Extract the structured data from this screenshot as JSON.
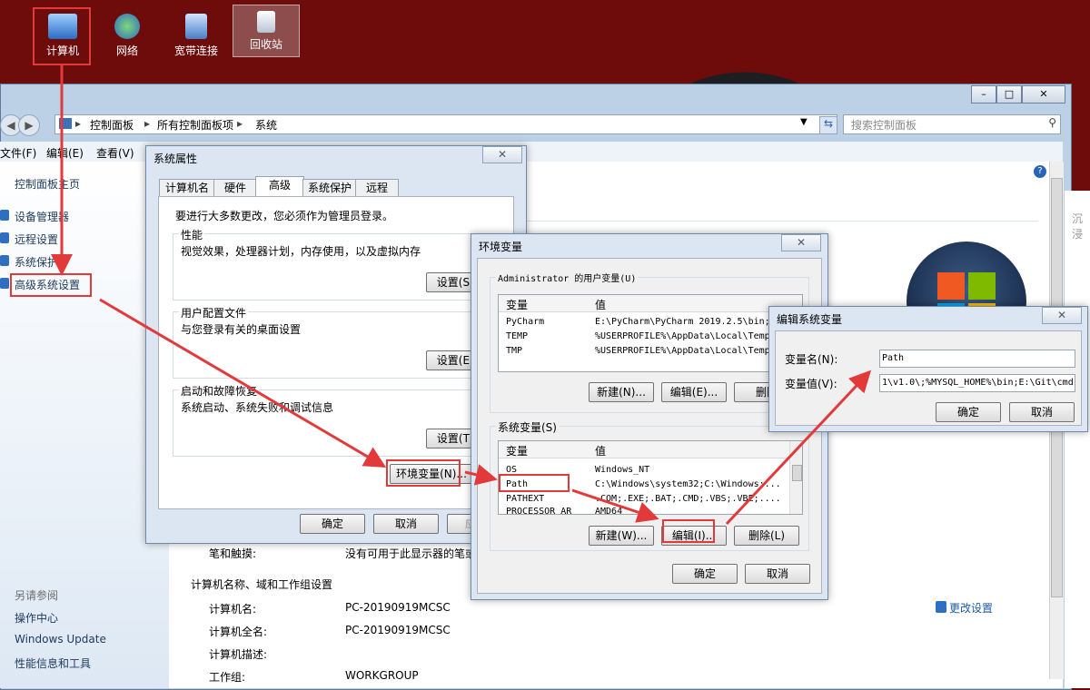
{
  "desktop": {
    "icons": [
      {
        "label": "计算机"
      },
      {
        "label": "网络"
      },
      {
        "label": "宽带连接"
      },
      {
        "label": "回收站"
      }
    ]
  },
  "explorer": {
    "breadcrumb": [
      "控制面板",
      "所有控制面板项",
      "系统"
    ],
    "search_placeholder": "搜索控制面板",
    "menu": [
      "文件(F)",
      "编辑(E)",
      "查看(V)"
    ],
    "sidebar": {
      "home": "控制面板主页",
      "items": [
        "设备管理器",
        "远程设置",
        "系统保护",
        "高级系统设置"
      ],
      "see_also_title": "另请参阅",
      "see_also": [
        "操作中心",
        "Windows Update",
        "性能信息和工具"
      ]
    },
    "content": {
      "pen_label": "笔和触摸:",
      "pen_value": "没有可用于此显示器的笔或",
      "section_title": "计算机名称、域和工作组设置",
      "rows": [
        {
          "label": "计算机名:",
          "value": "PC-20190919MCSC"
        },
        {
          "label": "计算机全名:",
          "value": "PC-20190919MCSC"
        },
        {
          "label": "计算机描述:",
          "value": ""
        },
        {
          "label": "工作组:",
          "value": "WORKGROUP"
        }
      ],
      "change_settings": "更改设置",
      "right_clip": "沉浸"
    }
  },
  "sys_props": {
    "title": "系统属性",
    "tabs": [
      "计算机名",
      "硬件",
      "高级",
      "系统保护",
      "远程"
    ],
    "admin_note": "要进行大多数更改，您必须作为管理员登录。",
    "groups": [
      {
        "title": "性能",
        "desc": "视觉效果，处理器计划，内存使用，以及虚拟内存",
        "button": "设置(S)..."
      },
      {
        "title": "用户配置文件",
        "desc": "与您登录有关的桌面设置",
        "button": "设置(E)..."
      },
      {
        "title": "启动和故障恢复",
        "desc": "系统启动、系统失败和调试信息",
        "button": "设置(T)..."
      }
    ],
    "env_button": "环境变量(N)...",
    "ok": "确定",
    "cancel": "取消",
    "apply": "应"
  },
  "env_vars": {
    "title": "环境变量",
    "user_group": "Administrator 的用户变量(U)",
    "col_var": "变量",
    "col_val": "值",
    "user_vars": [
      {
        "name": "PyCharm",
        "value": "E:\\PyCharm\\PyCharm 2019.2.5\\bin;"
      },
      {
        "name": "TEMP",
        "value": "%USERPROFILE%\\AppData\\Local\\Temp"
      },
      {
        "name": "TMP",
        "value": "%USERPROFILE%\\AppData\\Local\\Temp"
      }
    ],
    "user_buttons": [
      "新建(N)...",
      "编辑(E)...",
      "删除"
    ],
    "sys_group": "系统变量(S)",
    "sys_vars": [
      {
        "name": "OS",
        "value": "Windows_NT"
      },
      {
        "name": "Path",
        "value": "C:\\Windows\\system32;C:\\Windows;..."
      },
      {
        "name": "PATHEXT",
        "value": ".COM;.EXE;.BAT;.CMD;.VBS;.VBE;...."
      },
      {
        "name": "PROCESSOR_AR",
        "value": "AMD64"
      }
    ],
    "sys_buttons": [
      "新建(W)...",
      "编辑(I)...",
      "删除(L)"
    ],
    "ok": "确定",
    "cancel": "取消"
  },
  "edit_var": {
    "title": "编辑系统变量",
    "name_label": "变量名(N):",
    "name_value": "Path",
    "value_label": "变量值(V):",
    "value_value": "1\\v1.0\\;%MYSQL_HOME%\\bin;E:\\Git\\cmd",
    "ok": "确定",
    "cancel": "取消"
  },
  "colors": {
    "desktop_bg": "#6e0b0b",
    "highlight_red": "#e23a3a",
    "link": "#1e395b"
  }
}
